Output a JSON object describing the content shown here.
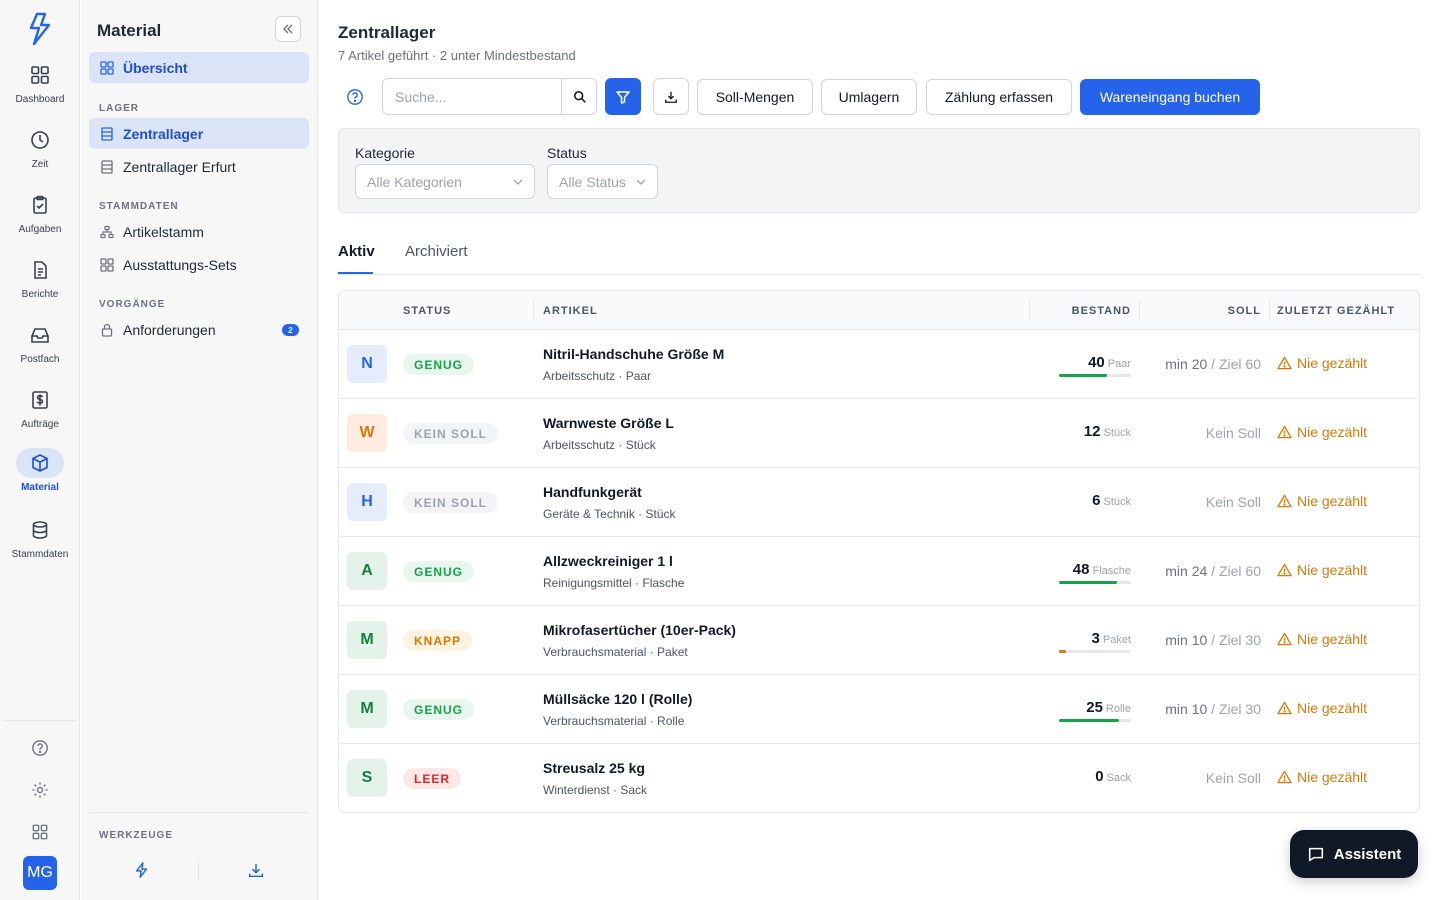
{
  "rail": {
    "items": [
      {
        "label": "Dashboard",
        "icon": "dashboard-icon"
      },
      {
        "label": "Zeit",
        "icon": "clock-icon"
      },
      {
        "label": "Aufgaben",
        "icon": "clipboard-check-icon"
      },
      {
        "label": "Berichte",
        "icon": "document-icon"
      },
      {
        "label": "Postfach",
        "icon": "inbox-icon"
      },
      {
        "label": "Aufträge",
        "icon": "dollar-document-icon"
      },
      {
        "label": "Material",
        "icon": "box-icon"
      },
      {
        "label": "Stammdaten",
        "icon": "database-icon"
      }
    ],
    "active": "Material",
    "avatar_initials": "MG"
  },
  "sidebar": {
    "title": "Material",
    "overview_label": "Übersicht",
    "section_lager": "LAGER",
    "lager_items": [
      {
        "label": "Zentrallager"
      },
      {
        "label": "Zentrallager Erfurt"
      }
    ],
    "section_stammdaten": "STAMMDATEN",
    "stammdaten_items": [
      {
        "label": "Artikelstamm"
      },
      {
        "label": "Ausstattungs-Sets"
      }
    ],
    "section_vorgaenge": "VORGÄNGE",
    "vorgaenge_items": [
      {
        "label": "Anforderungen",
        "badge": "2"
      }
    ],
    "section_tools": "WERKZEUGE"
  },
  "header": {
    "title": "Zentrallager",
    "subtitle": "7 Artikel geführt · 2 unter Mindestbestand"
  },
  "toolbar": {
    "search_placeholder": "Suche...",
    "soll_label": "Soll-Mengen",
    "umlagern_label": "Umlagern",
    "zaehlung_label": "Zählung erfassen",
    "wareneingang_label": "Wareneingang buchen"
  },
  "filters": {
    "kategorie_label": "Kategorie",
    "kategorie_value": "Alle Kategorien",
    "status_label": "Status",
    "status_value": "Alle Status"
  },
  "tabs": [
    {
      "label": "Aktiv"
    },
    {
      "label": "Archiviert"
    }
  ],
  "table": {
    "headers": {
      "status": "STATUS",
      "artikel": "ARTIKEL",
      "bestand": "BESTAND",
      "soll": "SOLL",
      "gezaehlt": "ZULETZT GEZÄHLT"
    },
    "rows": [
      {
        "initial": "N",
        "status": "GENUG",
        "name": "Nitril-Handschuhe Größe M",
        "meta": "Arbeitsschutz · Paar",
        "stock": "40",
        "unit": "Paar",
        "min": "min 20",
        "target": " / Ziel 60",
        "soll_text": "",
        "counted": "Nie gezählt",
        "fill": 0.67
      },
      {
        "initial": "W",
        "status": "KEIN SOLL",
        "name": "Warnweste Größe L",
        "meta": "Arbeitsschutz · Stück",
        "stock": "12",
        "unit": "Stück",
        "min": "",
        "target": "",
        "soll_text": "Kein Soll",
        "counted": "Nie gezählt",
        "fill": null
      },
      {
        "initial": "H",
        "status": "KEIN SOLL",
        "name": "Handfunkgerät",
        "meta": "Geräte & Technik · Stück",
        "stock": "6",
        "unit": "Stück",
        "min": "",
        "target": "",
        "soll_text": "Kein Soll",
        "counted": "Nie gezählt",
        "fill": null
      },
      {
        "initial": "A",
        "status": "GENUG",
        "name": "Allzweckreiniger 1 l",
        "meta": "Reinigungsmittel · Flasche",
        "stock": "48",
        "unit": "Flasche",
        "min": "min 24",
        "target": " / Ziel 60",
        "soll_text": "",
        "counted": "Nie gezählt",
        "fill": 0.8
      },
      {
        "initial": "M",
        "status": "KNAPP",
        "name": "Mikrofasertücher (10er-Pack)",
        "meta": "Verbrauchsmaterial · Paket",
        "stock": "3",
        "unit": "Paket",
        "min": "min 10",
        "target": " / Ziel 30",
        "soll_text": "",
        "counted": "Nie gezählt",
        "fill": 0.1
      },
      {
        "initial": "M",
        "status": "GENUG",
        "name": "Müllsäcke 120 l (Rolle)",
        "meta": "Verbrauchsmaterial · Rolle",
        "stock": "25",
        "unit": "Rolle",
        "min": "min 10",
        "target": " / Ziel 30",
        "soll_text": "",
        "counted": "Nie gezählt",
        "fill": 0.83
      },
      {
        "initial": "S",
        "status": "LEER",
        "name": "Streusalz 25 kg",
        "meta": "Winterdienst · Sack",
        "stock": "0",
        "unit": "Sack",
        "min": "",
        "target": "",
        "soll_text": "Kein Soll",
        "counted": "Nie gezählt",
        "fill": null
      }
    ]
  },
  "assistant": {
    "label": "Assistent"
  },
  "colors": {
    "accent": "#2563eb",
    "genug": "#16a34a",
    "knapp": "#d97706",
    "leer": "#dc2626",
    "kein_soll": "#9ca3af",
    "warning": "#d97706"
  }
}
